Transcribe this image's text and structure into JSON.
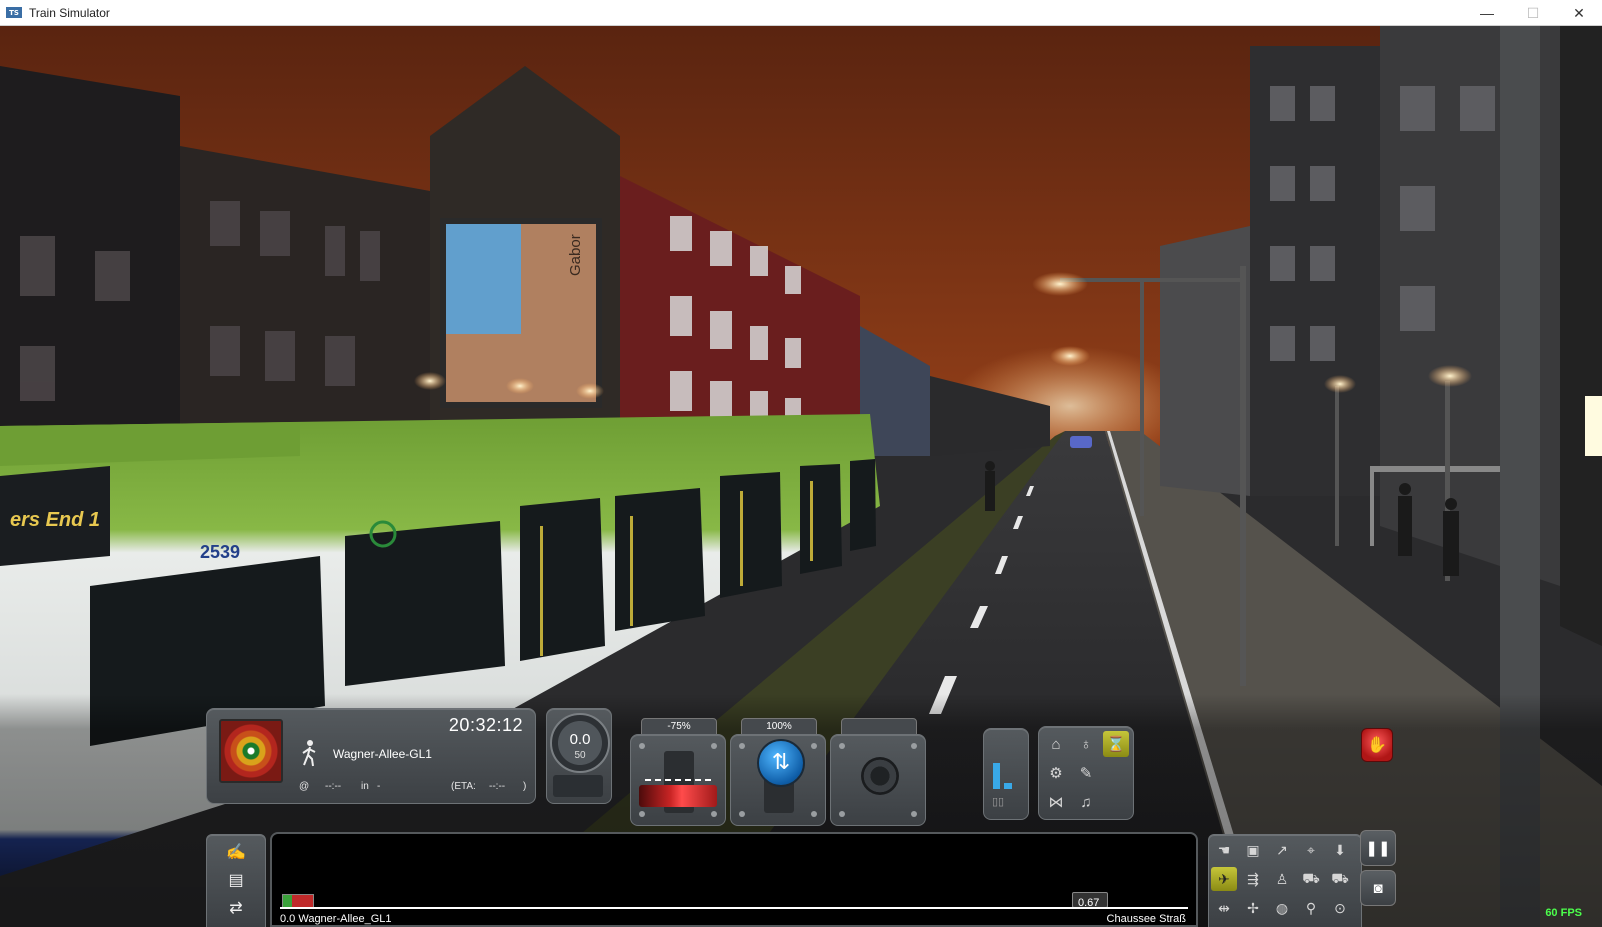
{
  "window": {
    "title": "Train Simulator",
    "icon_label": "TS"
  },
  "scene": {
    "tram_destination_sign": "ers End 1",
    "tram_number": "2539",
    "billboard_text": "Gabor"
  },
  "hud": {
    "clock": "20:32:12",
    "next_stop": "Wagner-Allee-GL1",
    "at_prefix": "@",
    "at_time": "--:--",
    "in_label": "in",
    "in_value": "-",
    "eta_label": "(ETA:",
    "eta_value": "--:--",
    "eta_close": ")",
    "speed": "0.0",
    "speed_limit": "50",
    "throttle_percent": "-75%",
    "reverser_percent": "100%",
    "camera_label": ""
  },
  "track_monitor": {
    "start_label": "0.0 Wagner-Allee_GL1",
    "distance": "0.67",
    "end_label": "Chaussee Straß"
  },
  "status": {
    "fps": "60 FPS"
  },
  "icons": {
    "grid": [
      "pantograph-icon",
      "headlight-icon",
      "sander-icon",
      "wiper-icon",
      "coupler-icon",
      "horn-icon",
      "bell-icon"
    ],
    "right_tools": [
      "driver-camera-icon",
      "cab-camera-icon",
      "head-out-camera-icon",
      "external-camera-icon",
      "down-arrow-icon",
      "helicopter-icon",
      "track-camera-icon",
      "passenger-icon",
      "tram-front-icon",
      "tram-rear-icon",
      "free-camera-icon",
      "plane-icon",
      "globe-icon",
      "map-pin-icon",
      "signal-icon"
    ]
  },
  "colors": {
    "sky": "#8a3a14",
    "accent_active": "#c6c63a",
    "brake_red": "#c82424",
    "reverser_blue": "#1e7ed6",
    "fps_green": "#4cff4c"
  }
}
